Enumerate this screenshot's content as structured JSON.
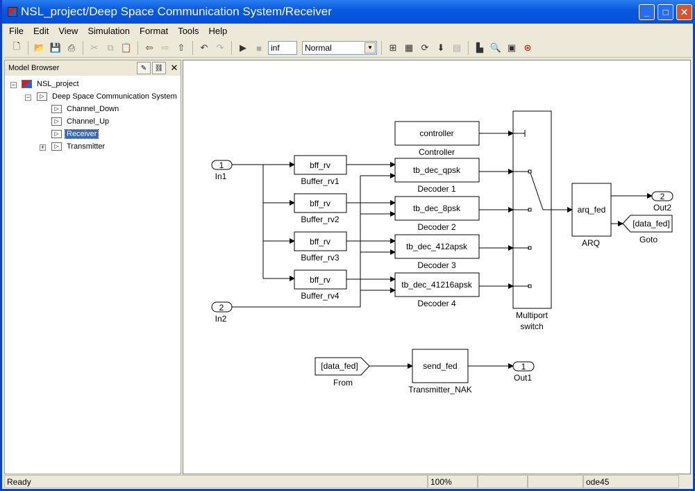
{
  "window": {
    "title": "NSL_project/Deep Space Communication System/Receiver"
  },
  "menu": [
    "File",
    "Edit",
    "View",
    "Simulation",
    "Format",
    "Tools",
    "Help"
  ],
  "toolbar": {
    "stop_time": "inf",
    "sim_mode": "Normal"
  },
  "browser": {
    "title": "Model Browser",
    "tree": [
      {
        "label": "NSL_project"
      },
      {
        "label": "Deep Space Communication System"
      },
      {
        "label": "Channel_Down"
      },
      {
        "label": "Channel_Up"
      },
      {
        "label": "Receiver",
        "selected": true
      },
      {
        "label": "Transmitter"
      }
    ]
  },
  "diagram": {
    "in1": {
      "num": "1",
      "label": "In1"
    },
    "in2": {
      "num": "2",
      "label": "In2"
    },
    "buffers": [
      {
        "text": "bff_rv",
        "label": "Buffer_rv1"
      },
      {
        "text": "bff_rv",
        "label": "Buffer_rv2"
      },
      {
        "text": "bff_rv",
        "label": "Buffer_rv3"
      },
      {
        "text": "bff_rv",
        "label": "Buffer_rv4"
      }
    ],
    "decoders": [
      {
        "text": "tb_dec_qpsk",
        "label": "Decoder 1"
      },
      {
        "text": "tb_dec_8psk",
        "label": "Decoder 2"
      },
      {
        "text": "tb_dec_412apsk",
        "label": "Decoder 3"
      },
      {
        "text": "tb_dec_41216apsk",
        "label": "Decoder 4"
      }
    ],
    "controller": {
      "text": "controller",
      "label": "Controller"
    },
    "switch": {
      "label1": "Multiport",
      "label2": "switch"
    },
    "arq": {
      "text": "arq_fed",
      "label": "ARQ"
    },
    "out2": {
      "num": "2",
      "label": "Out2"
    },
    "goto": {
      "text": "[data_fed]",
      "label": "Goto"
    },
    "from": {
      "text": "[data_fed]",
      "label": "From"
    },
    "nak": {
      "text": "send_fed",
      "label": "Transmitter_NAK"
    },
    "out1": {
      "num": "1",
      "label": "Out1"
    }
  },
  "status": {
    "text": "Ready",
    "zoom": "100%",
    "solver": "ode45"
  }
}
